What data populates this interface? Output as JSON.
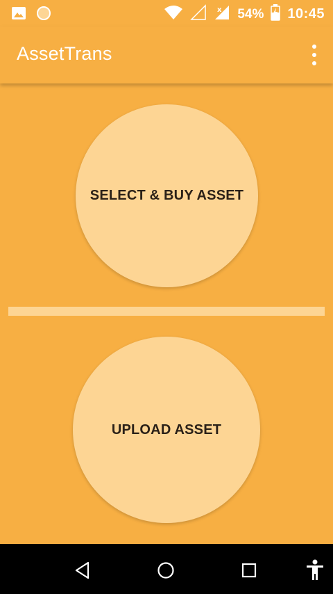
{
  "status_bar": {
    "left_icons": [
      "image-icon",
      "circle-notification-icon"
    ],
    "wifi_icon": "wifi-icon",
    "signal_icons": [
      "signal-empty-icon",
      "signal-no-data-icon"
    ],
    "battery_percent": "54%",
    "battery_icon": "battery-charging-icon",
    "time": "10:45"
  },
  "app_bar": {
    "title": "AssetTrans",
    "menu_icon": "overflow-menu-icon"
  },
  "main": {
    "select_buy_label": "SELECT & BUY ASSET",
    "upload_label": "UPLOAD ASSET"
  },
  "nav_bar": {
    "icons": [
      "back-icon",
      "home-icon",
      "recent-apps-icon",
      "accessibility-icon"
    ]
  },
  "colors": {
    "background": "#F7AF43",
    "button_fill": "#FDD594",
    "text_dark": "#2b2118",
    "nav_bg": "#000000"
  }
}
